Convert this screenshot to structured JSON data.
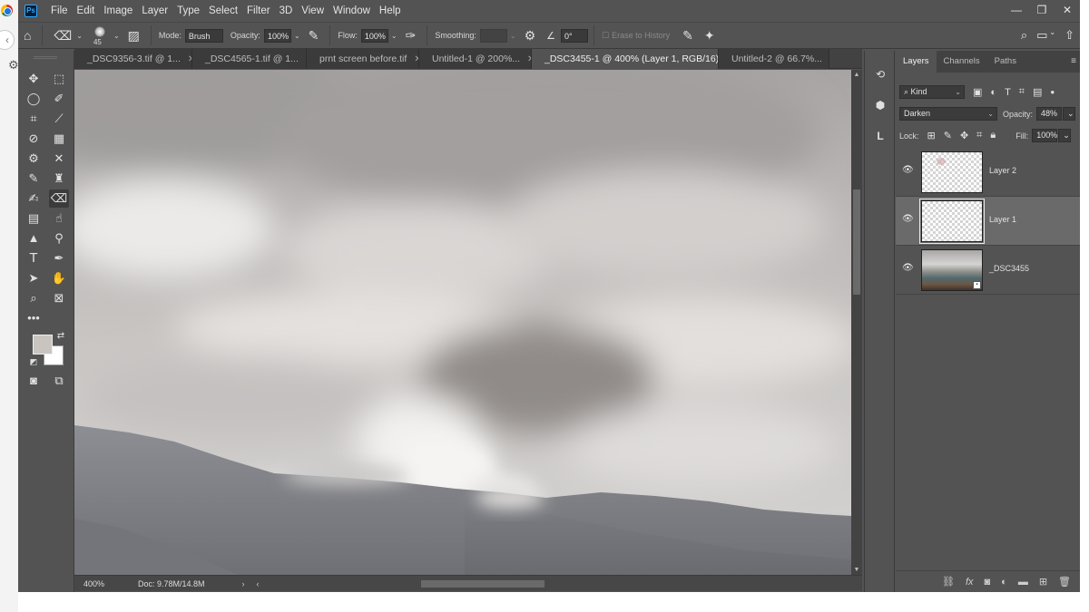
{
  "menu": [
    "File",
    "Edit",
    "Image",
    "Layer",
    "Type",
    "Select",
    "Filter",
    "3D",
    "View",
    "Window",
    "Help"
  ],
  "window_controls": {
    "minimize": "—",
    "restore": "❐",
    "close": "✕"
  },
  "options_bar": {
    "brush_size": "45",
    "mode_label": "Mode:",
    "mode_value": "Brush",
    "opacity_label": "Opacity:",
    "opacity_value": "100%",
    "flow_label": "Flow:",
    "flow_value": "100%",
    "smoothing_label": "Smoothing:",
    "smoothing_value": "",
    "angle_value": "0°",
    "erase_history_label": "Erase to History"
  },
  "tabs": [
    {
      "label": "_DSC9356-3.tif @ 1...",
      "active": false
    },
    {
      "label": "_DSC4565-1.tif @ 1...",
      "active": false
    },
    {
      "label": "prnt screen before.tif",
      "active": false
    },
    {
      "label": "Untitled-1 @ 200%...",
      "active": false
    },
    {
      "label": "_DSC3455-1 @ 400% (Layer 1, RGB/16) *",
      "active": true
    },
    {
      "label": "Untitled-2 @ 66.7%...",
      "active": false
    }
  ],
  "status": {
    "zoom": "400%",
    "doc": "Doc: 9.78M/14.8M"
  },
  "colors": {
    "foreground": "#c9c4bf",
    "background": "#ffffff",
    "ps_brand": "#31a8ff"
  },
  "layers_panel": {
    "tabs": [
      "Layers",
      "Channels",
      "Paths"
    ],
    "filter_kind": "Kind",
    "blend_mode": "Darken",
    "opacity_label": "Opacity:",
    "opacity_value": "48%",
    "lock_label": "Lock:",
    "fill_label": "Fill:",
    "fill_value": "100%",
    "layers": [
      {
        "name": "Layer 2",
        "visible": true,
        "selected": false
      },
      {
        "name": "Layer 1",
        "visible": true,
        "selected": true
      },
      {
        "name": "_DSC3455",
        "visible": true,
        "selected": false
      }
    ]
  }
}
